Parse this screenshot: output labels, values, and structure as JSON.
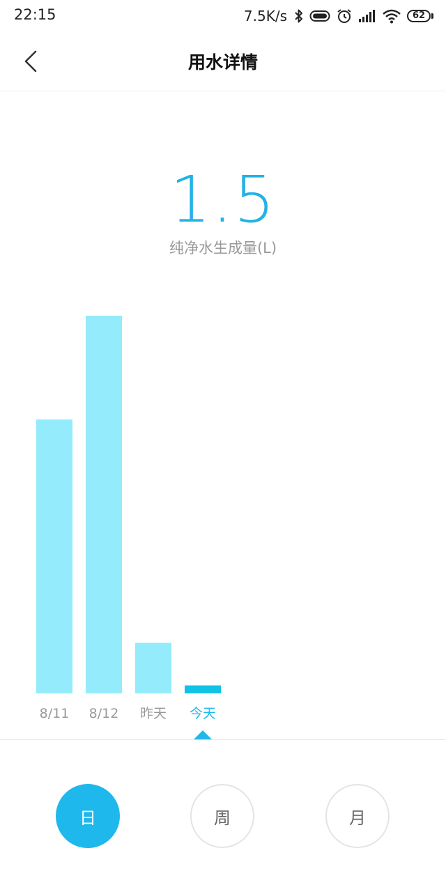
{
  "status_bar": {
    "time": "22:15",
    "net_speed": "7.5K/s",
    "icons": [
      "bluetooth-icon",
      "vr-icon",
      "alarm-icon",
      "signal-icon",
      "wifi-icon"
    ],
    "battery": "62"
  },
  "header": {
    "back_icon": "chevron-left-icon",
    "title": "用水详情"
  },
  "summary": {
    "value": "1.5",
    "label": "纯净水生成量(L)"
  },
  "colors": {
    "accent": "#1fb8ec",
    "bar": "#93ebfb",
    "bar_selected": "#12c1e6",
    "muted_text": "#999999"
  },
  "chart_data": {
    "type": "bar",
    "categories": [
      "8/11",
      "8/12",
      "昨天",
      "今天"
    ],
    "values": [
      10.3,
      14.2,
      1.9,
      0.3
    ],
    "ylim": [
      0,
      14.2
    ],
    "selected_index": 3,
    "grid": false,
    "title": "",
    "xlabel": "",
    "ylabel": ""
  },
  "period_tabs": [
    {
      "label": "日",
      "active": true
    },
    {
      "label": "周",
      "active": false
    },
    {
      "label": "月",
      "active": false
    }
  ]
}
